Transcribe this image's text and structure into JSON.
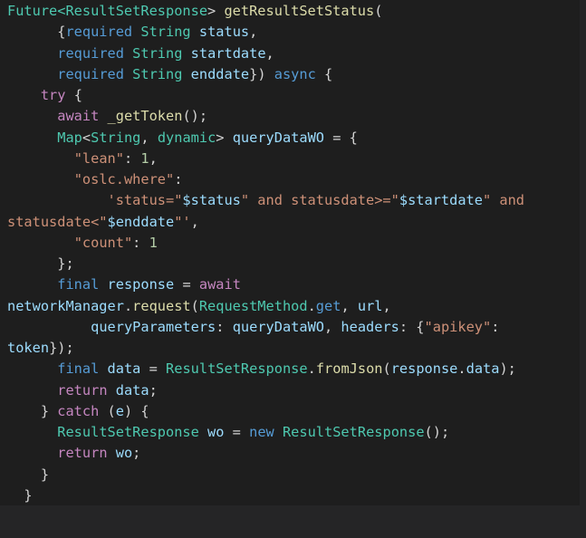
{
  "code_lines": [
    [
      {
        "t": "Future<",
        "c": "type"
      },
      {
        "t": "ResultSetResponse",
        "c": "type"
      },
      {
        "t": "> ",
        "c": "plain"
      },
      {
        "t": "getResultSetStatus",
        "c": "fn"
      },
      {
        "t": "(",
        "c": "punc"
      }
    ],
    [
      {
        "t": "      {",
        "c": "punc"
      },
      {
        "t": "required",
        "c": "kw"
      },
      {
        "t": " ",
        "c": "plain"
      },
      {
        "t": "String",
        "c": "type"
      },
      {
        "t": " ",
        "c": "plain"
      },
      {
        "t": "status",
        "c": "var"
      },
      {
        "t": ",",
        "c": "punc"
      }
    ],
    [
      {
        "t": "      ",
        "c": "plain"
      },
      {
        "t": "required",
        "c": "kw"
      },
      {
        "t": " ",
        "c": "plain"
      },
      {
        "t": "String",
        "c": "type"
      },
      {
        "t": " ",
        "c": "plain"
      },
      {
        "t": "startdate",
        "c": "var"
      },
      {
        "t": ",",
        "c": "punc"
      }
    ],
    [
      {
        "t": "      ",
        "c": "plain"
      },
      {
        "t": "required",
        "c": "kw"
      },
      {
        "t": " ",
        "c": "plain"
      },
      {
        "t": "String",
        "c": "type"
      },
      {
        "t": " ",
        "c": "plain"
      },
      {
        "t": "enddate",
        "c": "var"
      },
      {
        "t": "}) ",
        "c": "punc"
      },
      {
        "t": "async",
        "c": "kw"
      },
      {
        "t": " {",
        "c": "punc"
      }
    ],
    [
      {
        "t": "    ",
        "c": "plain"
      },
      {
        "t": "try",
        "c": "ctl"
      },
      {
        "t": " {",
        "c": "punc"
      }
    ],
    [
      {
        "t": "      ",
        "c": "plain"
      },
      {
        "t": "await",
        "c": "ctl"
      },
      {
        "t": " ",
        "c": "plain"
      },
      {
        "t": "_getToken",
        "c": "fn"
      },
      {
        "t": "();",
        "c": "punc"
      }
    ],
    [
      {
        "t": "      ",
        "c": "plain"
      },
      {
        "t": "Map",
        "c": "type"
      },
      {
        "t": "<",
        "c": "punc"
      },
      {
        "t": "String",
        "c": "type"
      },
      {
        "t": ", ",
        "c": "punc"
      },
      {
        "t": "dynamic",
        "c": "type"
      },
      {
        "t": "> ",
        "c": "punc"
      },
      {
        "t": "queryDataWO",
        "c": "var"
      },
      {
        "t": " = {",
        "c": "punc"
      }
    ],
    [
      {
        "t": "        ",
        "c": "plain"
      },
      {
        "t": "\"lean\"",
        "c": "str"
      },
      {
        "t": ": ",
        "c": "punc"
      },
      {
        "t": "1",
        "c": "num"
      },
      {
        "t": ",",
        "c": "punc"
      }
    ],
    [
      {
        "t": "        ",
        "c": "plain"
      },
      {
        "t": "\"oslc.where\"",
        "c": "str"
      },
      {
        "t": ":",
        "c": "punc"
      }
    ],
    [
      {
        "t": "            ",
        "c": "plain"
      },
      {
        "t": "'status=\"",
        "c": "str"
      },
      {
        "t": "$status",
        "c": "var"
      },
      {
        "t": "\" and statusdate>=\"",
        "c": "str"
      },
      {
        "t": "$startdate",
        "c": "var"
      },
      {
        "t": "\" and",
        "c": "str"
      }
    ],
    [
      {
        "t": "statusdate<\"",
        "c": "str"
      },
      {
        "t": "$enddate",
        "c": "var"
      },
      {
        "t": "\"'",
        "c": "str"
      },
      {
        "t": ",",
        "c": "punc"
      }
    ],
    [
      {
        "t": "        ",
        "c": "plain"
      },
      {
        "t": "\"count\"",
        "c": "str"
      },
      {
        "t": ": ",
        "c": "punc"
      },
      {
        "t": "1",
        "c": "num"
      }
    ],
    [
      {
        "t": "      };",
        "c": "punc"
      }
    ],
    [
      {
        "t": "      ",
        "c": "plain"
      },
      {
        "t": "final",
        "c": "kw"
      },
      {
        "t": " ",
        "c": "plain"
      },
      {
        "t": "response",
        "c": "var"
      },
      {
        "t": " = ",
        "c": "punc"
      },
      {
        "t": "await",
        "c": "ctl"
      }
    ],
    [
      {
        "t": "networkManager",
        "c": "var"
      },
      {
        "t": ".",
        "c": "punc"
      },
      {
        "t": "request",
        "c": "fn"
      },
      {
        "t": "(",
        "c": "punc"
      },
      {
        "t": "RequestMethod",
        "c": "type"
      },
      {
        "t": ".",
        "c": "punc"
      },
      {
        "t": "get",
        "c": "kw"
      },
      {
        "t": ", ",
        "c": "punc"
      },
      {
        "t": "url",
        "c": "var"
      },
      {
        "t": ",",
        "c": "punc"
      }
    ],
    [
      {
        "t": "          ",
        "c": "plain"
      },
      {
        "t": "queryParameters",
        "c": "var"
      },
      {
        "t": ": ",
        "c": "punc"
      },
      {
        "t": "queryDataWO",
        "c": "var"
      },
      {
        "t": ", ",
        "c": "punc"
      },
      {
        "t": "headers",
        "c": "var"
      },
      {
        "t": ": {",
        "c": "punc"
      },
      {
        "t": "\"apikey\"",
        "c": "str"
      },
      {
        "t": ":",
        "c": "punc"
      }
    ],
    [
      {
        "t": "token",
        "c": "var"
      },
      {
        "t": "});",
        "c": "punc"
      }
    ],
    [
      {
        "t": "      ",
        "c": "plain"
      },
      {
        "t": "final",
        "c": "kw"
      },
      {
        "t": " ",
        "c": "plain"
      },
      {
        "t": "data",
        "c": "var"
      },
      {
        "t": " = ",
        "c": "punc"
      },
      {
        "t": "ResultSetResponse",
        "c": "type"
      },
      {
        "t": ".",
        "c": "punc"
      },
      {
        "t": "fromJson",
        "c": "fn"
      },
      {
        "t": "(",
        "c": "punc"
      },
      {
        "t": "response",
        "c": "var"
      },
      {
        "t": ".",
        "c": "punc"
      },
      {
        "t": "data",
        "c": "var"
      },
      {
        "t": ");",
        "c": "punc"
      }
    ],
    [
      {
        "t": "      ",
        "c": "plain"
      },
      {
        "t": "return",
        "c": "ctl"
      },
      {
        "t": " ",
        "c": "plain"
      },
      {
        "t": "data",
        "c": "var"
      },
      {
        "t": ";",
        "c": "punc"
      }
    ],
    [
      {
        "t": "    } ",
        "c": "punc"
      },
      {
        "t": "catch",
        "c": "ctl"
      },
      {
        "t": " (",
        "c": "punc"
      },
      {
        "t": "e",
        "c": "var"
      },
      {
        "t": ") {",
        "c": "punc"
      }
    ],
    [
      {
        "t": "      ",
        "c": "plain"
      },
      {
        "t": "ResultSetResponse",
        "c": "type"
      },
      {
        "t": " ",
        "c": "plain"
      },
      {
        "t": "wo",
        "c": "var"
      },
      {
        "t": " = ",
        "c": "punc"
      },
      {
        "t": "new",
        "c": "kw"
      },
      {
        "t": " ",
        "c": "plain"
      },
      {
        "t": "ResultSetResponse",
        "c": "type"
      },
      {
        "t": "();",
        "c": "punc"
      }
    ],
    [
      {
        "t": "      ",
        "c": "plain"
      },
      {
        "t": "return",
        "c": "ctl"
      },
      {
        "t": " ",
        "c": "plain"
      },
      {
        "t": "wo",
        "c": "var"
      },
      {
        "t": ";",
        "c": "punc"
      }
    ],
    [
      {
        "t": "    }",
        "c": "punc"
      }
    ],
    [
      {
        "t": "  }",
        "c": "punc"
      }
    ]
  ],
  "colors": {
    "background": "#1e1e1e",
    "type": "#4ec9b0",
    "fn": "#dcdcaa",
    "kw": "#569cd6",
    "ctl": "#c586c0",
    "var": "#9cdcfe",
    "str": "#ce9178",
    "num": "#b5cea8",
    "punc": "#d4d4d4",
    "plain": "#d4d4d4"
  }
}
